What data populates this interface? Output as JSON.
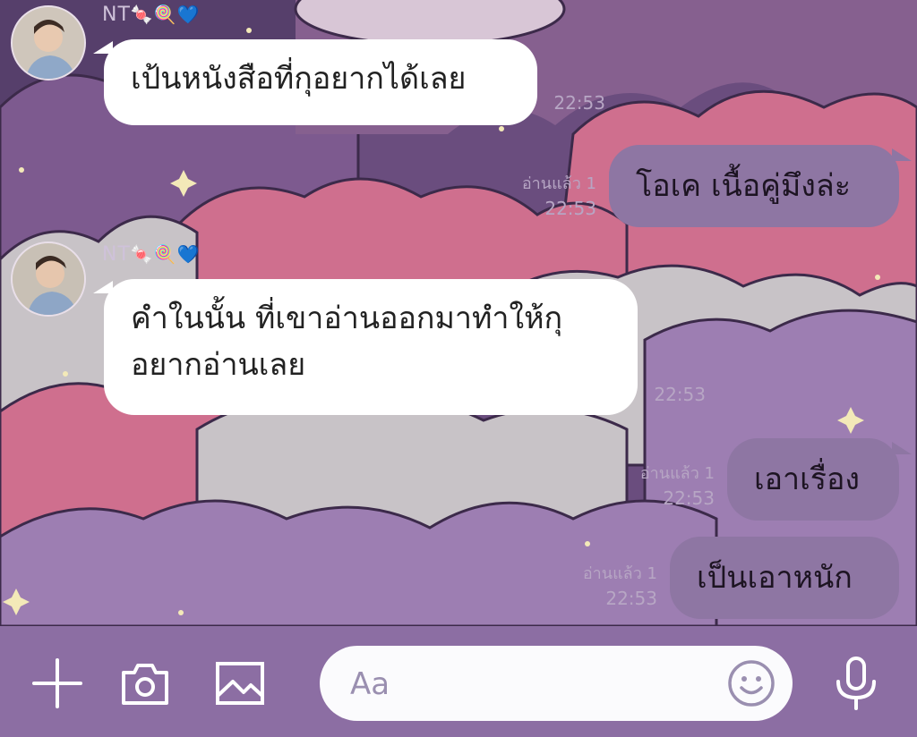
{
  "chat": {
    "messages": [
      {
        "sender": "NT",
        "sender_emojis": "🍬🍭💙",
        "text": "เป้นหนังสือที่กุอยากได้เลย",
        "time": "22:53"
      },
      {
        "text": "โอเค เนื้อคู่มึงล่ะ",
        "read": "อ่านแล้ว 1",
        "time": "22:53"
      },
      {
        "sender": "NT",
        "sender_emojis": "🍬🍭💙",
        "text_line1": "คำในนั้น ที่เขาอ่านออกมาทำให้กุ",
        "text_line2": "อยากอ่านเลย",
        "time": "22:53"
      },
      {
        "text": "เอาเรื่อง",
        "read": "อ่านแล้ว 1",
        "time": "22:53"
      },
      {
        "text": "เป็นเอาหนัก",
        "read": "อ่านแล้ว 1",
        "time": "22:53"
      }
    ]
  },
  "composer": {
    "placeholder": "Aa",
    "icons": [
      "plus-icon",
      "camera-icon",
      "image-icon",
      "smiley-icon",
      "microphone-icon"
    ]
  },
  "colors": {
    "bubble_in": "#ffffff",
    "bubble_out": "#8e76a3",
    "composer_bg": "#8c6ea3"
  }
}
